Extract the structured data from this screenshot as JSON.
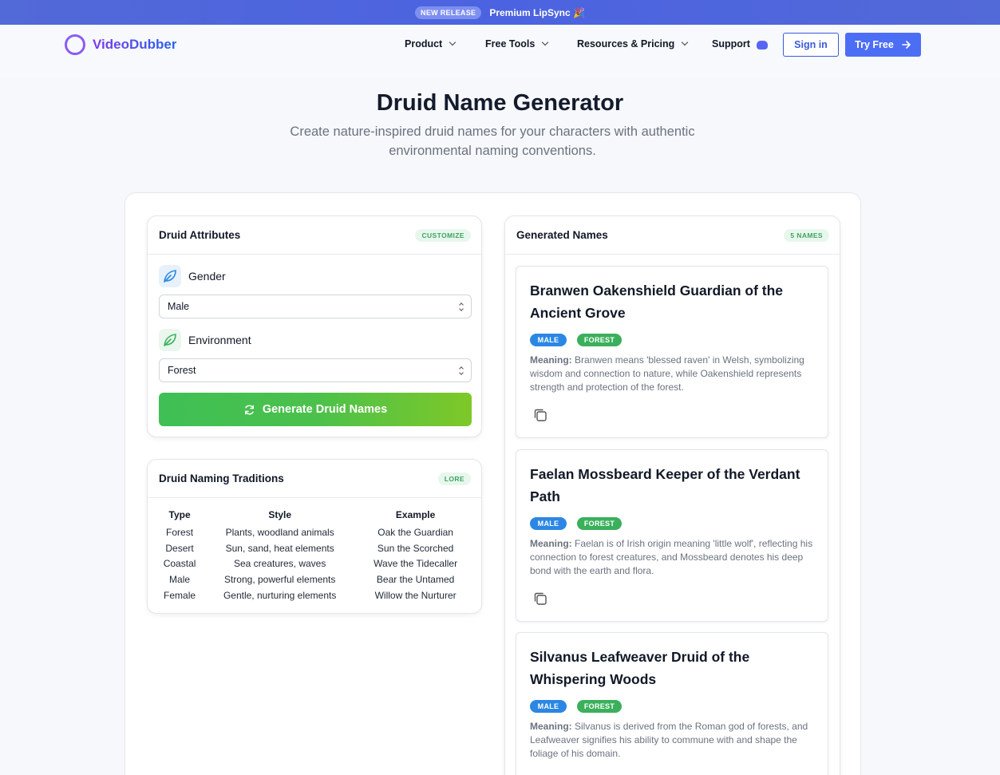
{
  "announcement": {
    "pill": "NEW RELEASE",
    "message": "Premium LipSync 🎉"
  },
  "header": {
    "logo_text": "VideoDubber",
    "nav": [
      {
        "label": "Product",
        "dropdown": true
      },
      {
        "label": "Free Tools",
        "dropdown": true
      },
      {
        "label": "Resources & Pricing",
        "dropdown": true
      },
      {
        "label": "Support",
        "dropdown": false
      }
    ],
    "signin_label": "Sign in",
    "try_label": "Try Free"
  },
  "hero": {
    "title": "Druid Name Generator",
    "subtitle": "Create nature-inspired druid names for your characters with authentic environmental naming conventions."
  },
  "attributes": {
    "title": "Druid Attributes",
    "tag": "CUSTOMIZE",
    "gender_label": "Gender",
    "gender_value": "Male",
    "environment_label": "Environment",
    "environment_value": "Forest",
    "generate_label": "Generate Druid Names"
  },
  "traditions": {
    "title": "Druid Naming Traditions",
    "tag": "LORE",
    "headers": [
      "Type",
      "Style",
      "Example"
    ],
    "rows": [
      [
        "Forest",
        "Plants, woodland animals",
        "Oak the Guardian"
      ],
      [
        "Desert",
        "Sun, sand, heat elements",
        "Sun the Scorched"
      ],
      [
        "Coastal",
        "Sea creatures, waves",
        "Wave the Tidecaller"
      ],
      [
        "Male",
        "Strong, powerful elements",
        "Bear the Untamed"
      ],
      [
        "Female",
        "Gentle, nurturing elements",
        "Willow the Nurturer"
      ]
    ]
  },
  "results": {
    "title": "Generated Names",
    "tag": "5 NAMES",
    "meaning_label": "Meaning:",
    "names": [
      {
        "name": "Branwen Oakenshield Guardian of the Ancient Grove",
        "gender": "MALE",
        "environment": "FOREST",
        "meaning": "Branwen means 'blessed raven' in Welsh, symbolizing wisdom and connection to nature, while Oakenshield represents strength and protection of the forest."
      },
      {
        "name": "Faelan Mossbeard Keeper of the Verdant Path",
        "gender": "MALE",
        "environment": "FOREST",
        "meaning": "Faelan is of Irish origin meaning 'little wolf', reflecting his connection to forest creatures, and Mossbeard denotes his deep bond with the earth and flora."
      },
      {
        "name": "Silvanus Leafweaver Druid of the Whispering Woods",
        "gender": "MALE",
        "environment": "FOREST",
        "meaning": "Silvanus is derived from the Roman god of forests, and Leafweaver signifies his ability to commune with and shape the foliage of his domain."
      }
    ]
  },
  "colors": {
    "accent": "#4c6ef5",
    "green": "#3bb05c",
    "blue_badge": "#2b87e3"
  }
}
